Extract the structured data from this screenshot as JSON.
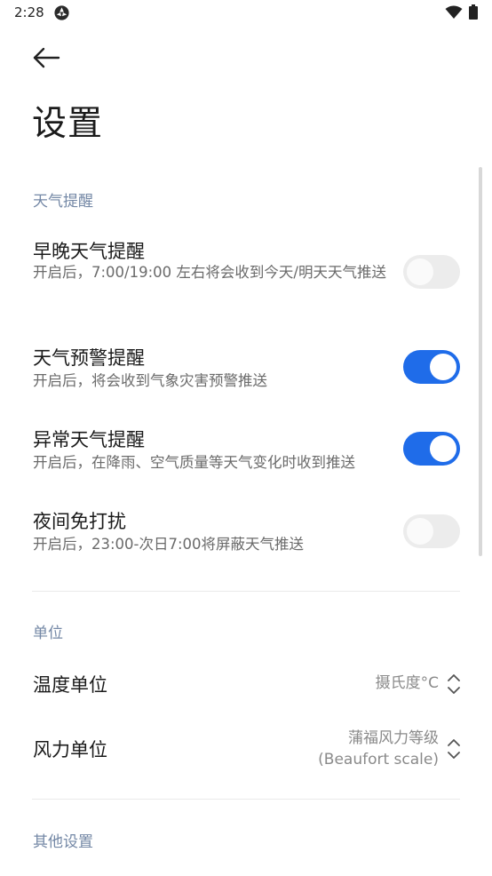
{
  "status_bar": {
    "time": "2:28"
  },
  "header": {
    "title": "设置"
  },
  "weather_alerts": {
    "section_title": "天气提醒",
    "items": [
      {
        "title": "早晚天气提醒",
        "description": "开启后，7:00/19:00 左右将会收到今天/明天天气推送",
        "enabled": false
      },
      {
        "title": "天气预警提醒",
        "description": "开启后，将会收到气象灾害预警推送",
        "enabled": true
      },
      {
        "title": "异常天气提醒",
        "description": "开启后，在降雨、空气质量等天气变化时收到推送",
        "enabled": true
      },
      {
        "title": "夜间免打扰",
        "description": "开启后，23:00-次日7:00将屏蔽天气推送",
        "enabled": false
      }
    ]
  },
  "units": {
    "section_title": "单位",
    "temperature": {
      "label": "温度单位",
      "value": "摄氏度°C"
    },
    "wind": {
      "label": "风力单位",
      "value_line1": "蒲福风力等级",
      "value_line2": "(Beaufort scale)"
    }
  },
  "other": {
    "section_title": "其他设置"
  },
  "colors": {
    "accent": "#1f6ce9",
    "section_header": "#7488a6",
    "toggle_off": "#ececec"
  }
}
